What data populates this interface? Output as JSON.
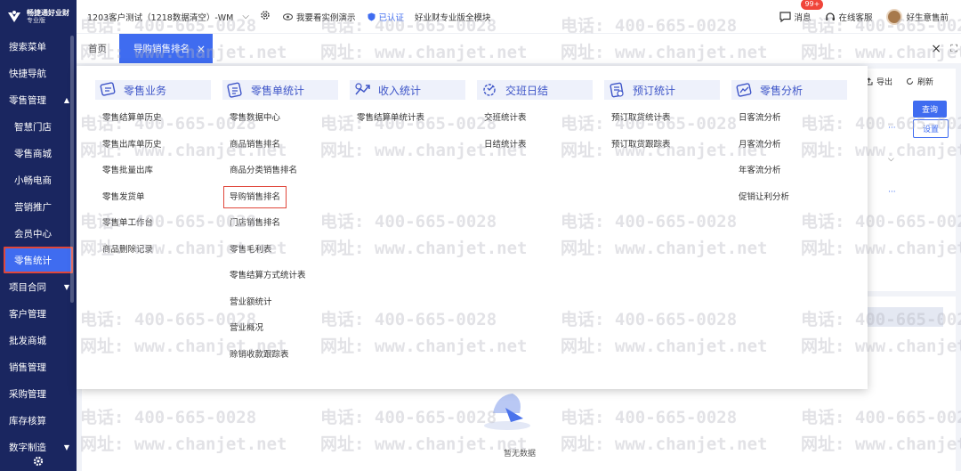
{
  "brand": {
    "name": "畅捷通好业财",
    "edition": "专业版"
  },
  "topbar": {
    "company": "1203客户测试（1218数据清空）-WM",
    "demo": "我要看实例演示",
    "certified": "已认证",
    "edition": "好业财专业版全模块",
    "message_label": "消息",
    "message_badge": "99+",
    "service_label": "在线客服",
    "user_label": "好生意售前"
  },
  "sidebar": {
    "items": [
      {
        "label": "搜索菜单"
      },
      {
        "label": "快捷导航"
      },
      {
        "label": "零售管理",
        "caret": "▲"
      },
      {
        "label": "智慧门店"
      },
      {
        "label": "零售商城"
      },
      {
        "label": "小畅电商"
      },
      {
        "label": "营销推广"
      },
      {
        "label": "会员中心"
      },
      {
        "label": "零售统计"
      },
      {
        "label": "项目合同",
        "caret": "▼"
      },
      {
        "label": "客户管理"
      },
      {
        "label": "批发商城"
      },
      {
        "label": "销售管理"
      },
      {
        "label": "采购管理"
      },
      {
        "label": "库存核算"
      },
      {
        "label": "数字制造",
        "caret": "▼"
      }
    ]
  },
  "tabs": {
    "home": "首页",
    "active": "导购销售排名",
    "close": "×"
  },
  "background": {
    "export": "导出",
    "refresh": "刷新",
    "query": "查询",
    "settings": "设置",
    "more": "···",
    "empty": "暂无数据"
  },
  "panel": {
    "columns": [
      {
        "title": "零售业务",
        "icon": "retail-business-icon",
        "items": [
          "零售结算单历史",
          "零售出库单历史",
          "零售批量出库",
          "零售发货单",
          "零售单工作台",
          "商品删除记录"
        ]
      },
      {
        "title": "零售单统计",
        "icon": "retail-order-stats-icon",
        "items": [
          "零售数据中心",
          "商品销售排名",
          "商品分类销售排名",
          "导购销售排名",
          "门店销售排名",
          "零售毛利表",
          "零售结算方式统计表",
          "营业额统计",
          "营业概况",
          "赊销收款跟踪表"
        ]
      },
      {
        "title": "收入统计",
        "icon": "income-stats-icon",
        "items": [
          "零售结算单统计表"
        ]
      },
      {
        "title": "交班日结",
        "icon": "shift-settlement-icon",
        "items": [
          "交班统计表",
          "日结统计表"
        ]
      },
      {
        "title": "预订统计",
        "icon": "reservation-stats-icon",
        "items": [
          "预订取货统计表",
          "预订取货跟踪表"
        ]
      },
      {
        "title": "零售分析",
        "icon": "retail-analysis-icon",
        "items": [
          "日客流分析",
          "月客流分析",
          "年客流分析",
          "促销让利分析"
        ]
      }
    ],
    "highlighted": "导购销售排名"
  },
  "watermark": {
    "phone": "电话: 400-665-0028",
    "url": "网址: www.chanjet.net"
  },
  "colors": {
    "sidebar_bg": "#1a2660",
    "accent": "#3f6cf0",
    "highlight_border": "#e0463a",
    "badge": "#f0453a"
  }
}
